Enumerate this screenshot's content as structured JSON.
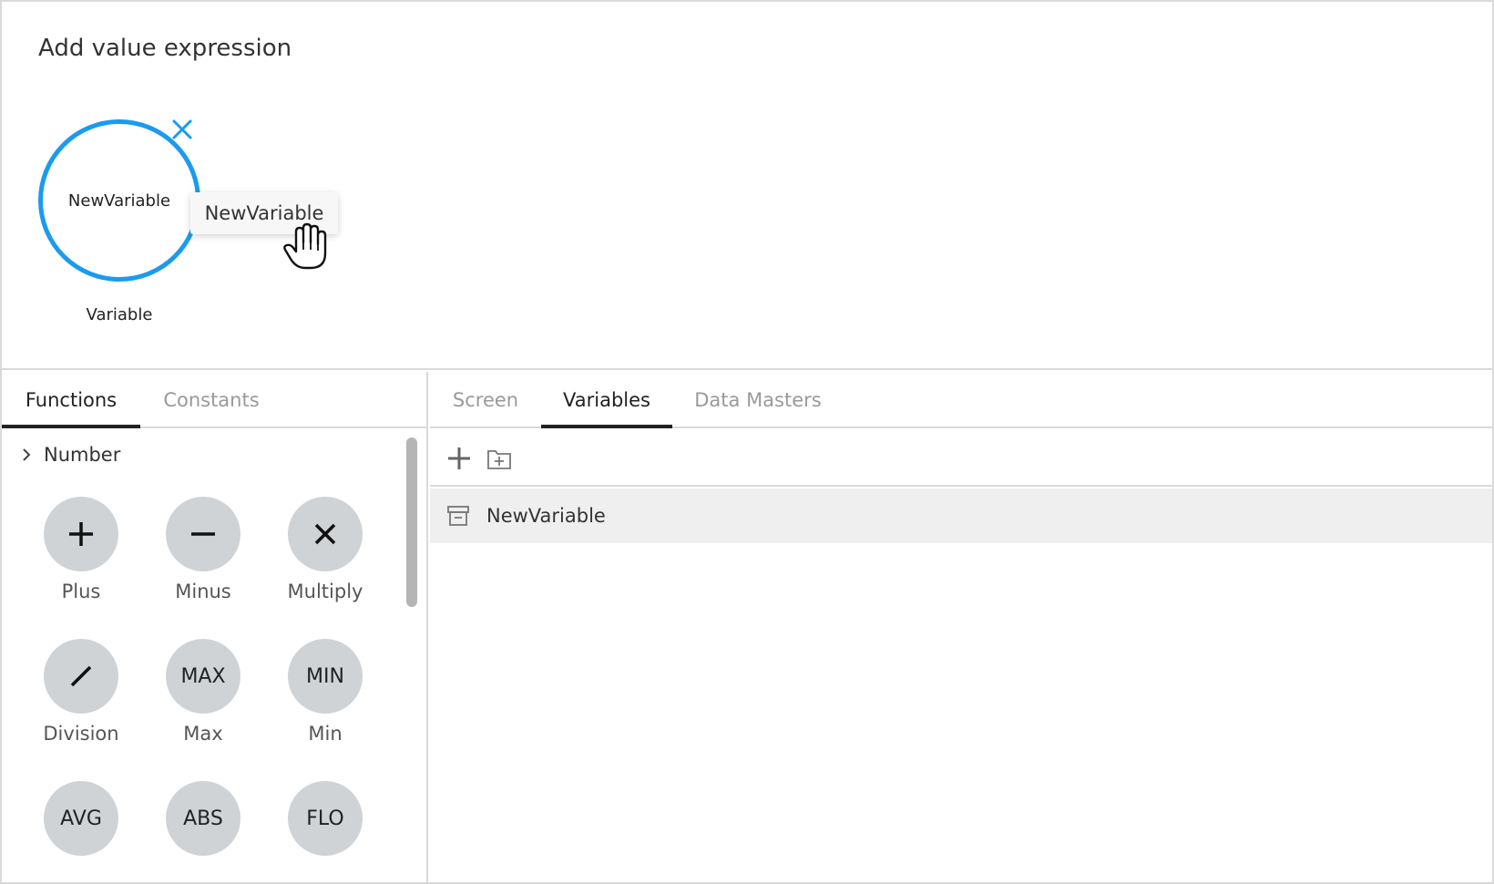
{
  "editor": {
    "title": "Add value expression",
    "node": {
      "label": "NewVariable",
      "caption": "Variable",
      "accent": "#1a9bf0"
    },
    "drag_chip": {
      "label": "NewVariable"
    }
  },
  "left_panel": {
    "tabs": [
      {
        "label": "Functions",
        "active": true
      },
      {
        "label": "Constants",
        "active": false
      }
    ],
    "category": {
      "label": "Number"
    },
    "functions": [
      {
        "name": "plus",
        "symbol": "+",
        "label": "Plus"
      },
      {
        "name": "minus",
        "symbol": "−",
        "label": "Minus"
      },
      {
        "name": "multiply",
        "symbol": "×",
        "label": "Multiply"
      },
      {
        "name": "division",
        "symbol": "/",
        "label": "Division"
      },
      {
        "name": "max",
        "symbol": "MAX",
        "label": "Max"
      },
      {
        "name": "min",
        "symbol": "MIN",
        "label": "Min"
      },
      {
        "name": "avg",
        "symbol": "AVG",
        "label": ""
      },
      {
        "name": "abs",
        "symbol": "ABS",
        "label": ""
      },
      {
        "name": "flo",
        "symbol": "FLO",
        "label": ""
      }
    ]
  },
  "right_panel": {
    "tabs": [
      {
        "label": "Screen",
        "active": false
      },
      {
        "label": "Variables",
        "active": true
      },
      {
        "label": "Data Masters",
        "active": false
      }
    ],
    "variables": [
      {
        "name": "NewVariable"
      }
    ]
  }
}
